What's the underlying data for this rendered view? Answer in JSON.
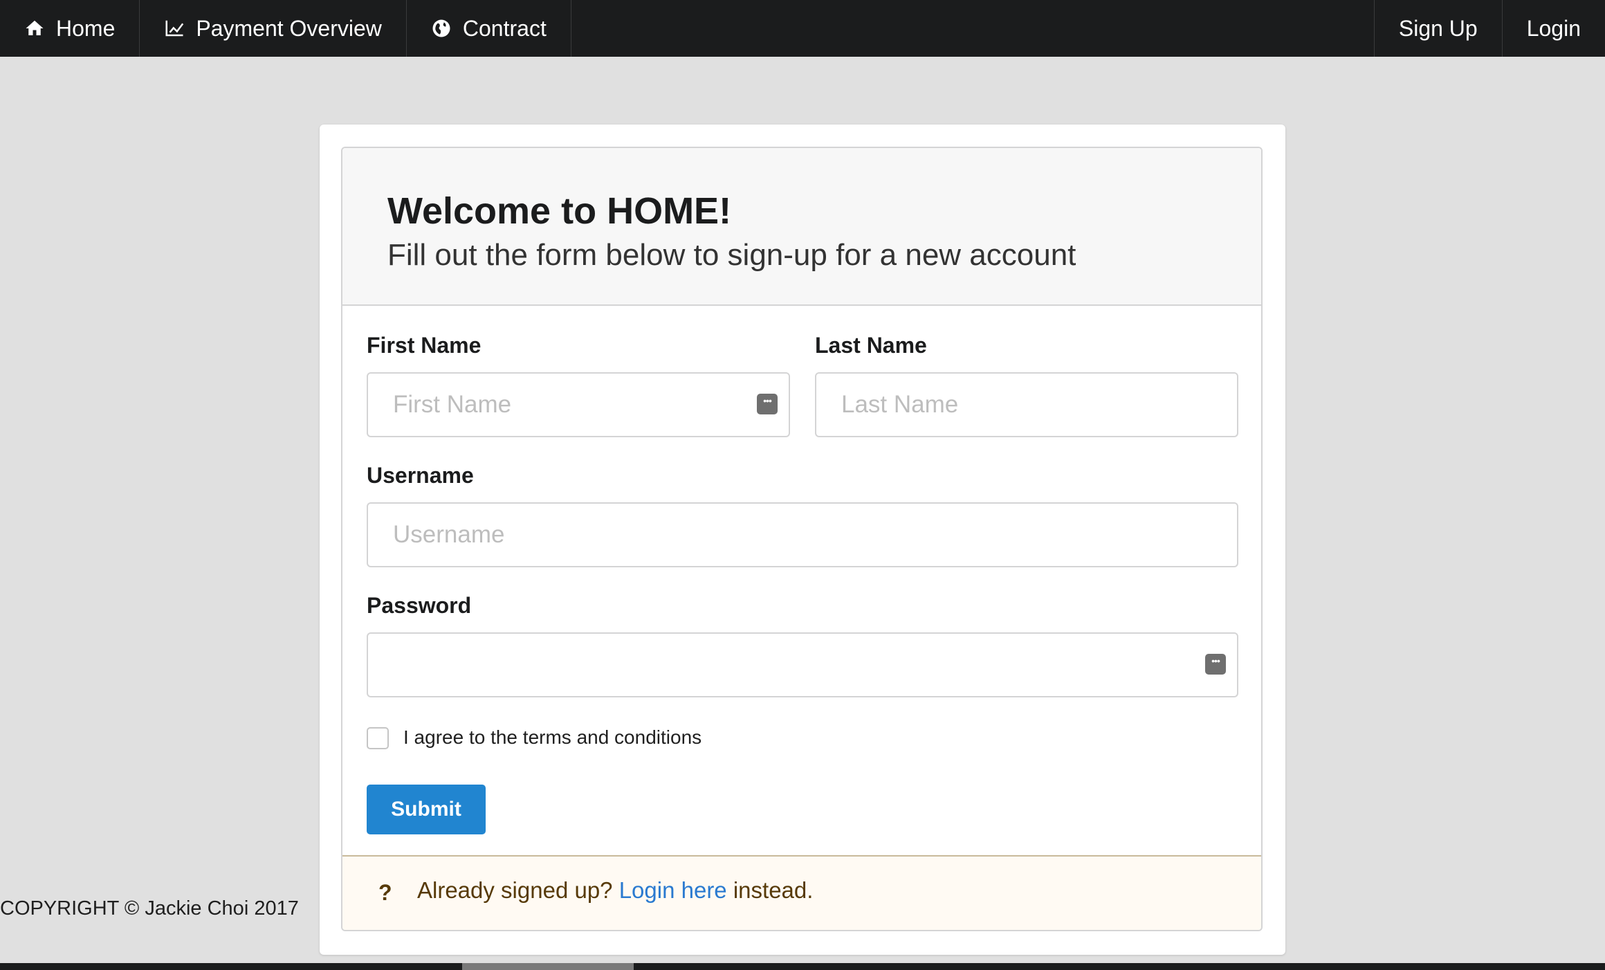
{
  "nav": {
    "home": {
      "label": "Home",
      "icon": "home-icon"
    },
    "payment": {
      "label": "Payment Overview",
      "icon": "line-chart-icon"
    },
    "contract": {
      "label": "Contract",
      "icon": "globe-icon"
    },
    "signup": {
      "label": "Sign Up"
    },
    "login": {
      "label": "Login"
    }
  },
  "form": {
    "title": "Welcome to HOME!",
    "subtitle": "Fill out the form below to sign-up for a new account",
    "first_name": {
      "label": "First Name",
      "placeholder": "First Name",
      "value": ""
    },
    "last_name": {
      "label": "Last Name",
      "placeholder": "Last Name",
      "value": ""
    },
    "username": {
      "label": "Username",
      "placeholder": "Username",
      "value": ""
    },
    "password": {
      "label": "Password",
      "placeholder": "",
      "value": ""
    },
    "terms_label": "I agree to the terms and conditions",
    "terms_checked": false,
    "submit_label": "Submit"
  },
  "message": {
    "icon": "?",
    "prefix": "Already signed up?",
    "link": "Login here",
    "suffix": "instead."
  },
  "footer": {
    "copyright": "COPYRIGHT © Jackie Choi 2017"
  },
  "colors": {
    "nav_bg": "#1b1c1d",
    "primary": "#2185d0",
    "page_bg": "#e0e0e0",
    "message_bg": "#fffaf3",
    "link": "#2a7ad0"
  }
}
